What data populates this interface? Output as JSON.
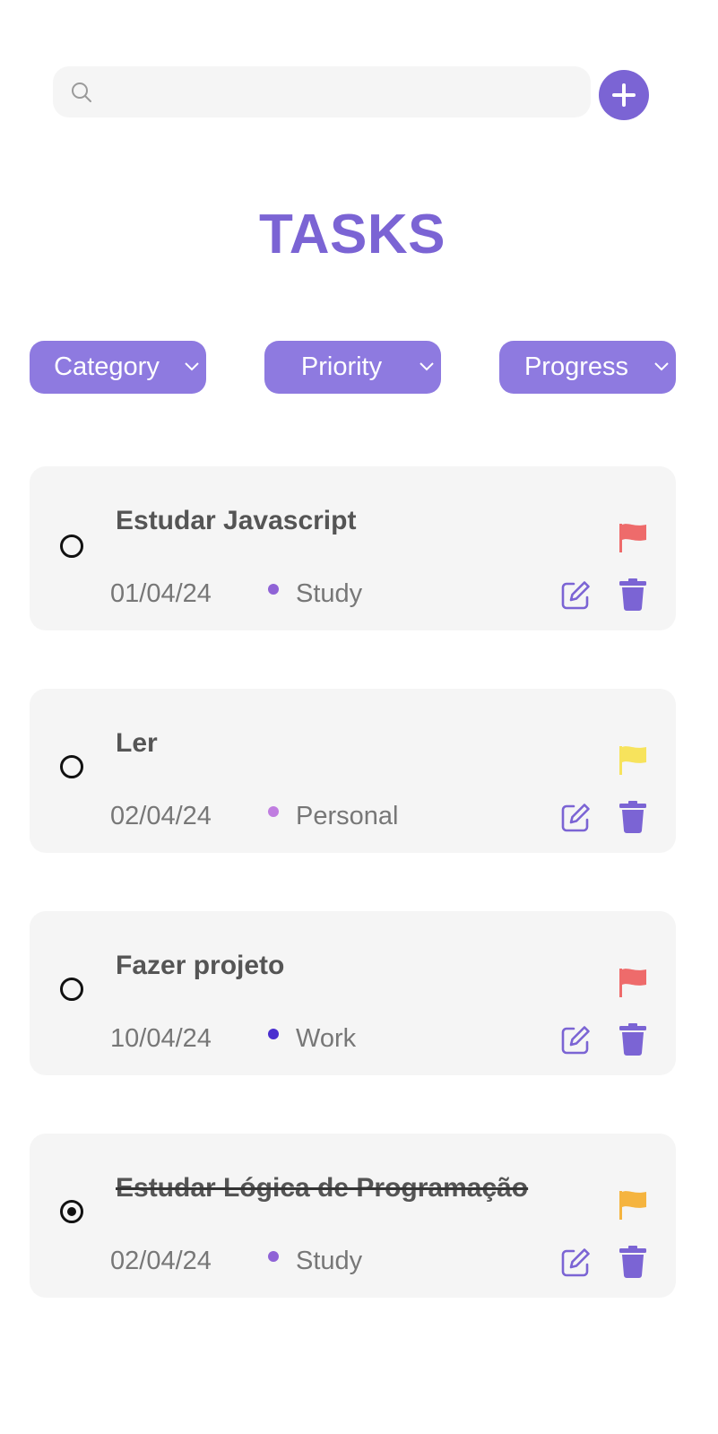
{
  "search": {
    "value": "",
    "placeholder": "",
    "icon": "search-icon"
  },
  "add_button": {
    "icon": "plus-icon",
    "color": "#7b64d4"
  },
  "title": "TASKS",
  "filters": [
    {
      "label": "Category",
      "icon": "chevron-down-icon"
    },
    {
      "label": "Priority",
      "icon": "chevron-down-icon"
    },
    {
      "label": "Progress",
      "icon": "chevron-down-icon"
    }
  ],
  "tasks": [
    {
      "title": "Estudar Javascript",
      "date": "01/04/24",
      "category": "Study",
      "category_color": "#8f63d6",
      "priority_color": "#ee6b6b",
      "done": false
    },
    {
      "title": "Ler",
      "date": "02/04/24",
      "category": "Personal",
      "category_color": "#c07de0",
      "priority_color": "#f7e35c",
      "done": false
    },
    {
      "title": "Fazer projeto",
      "date": "10/04/24",
      "category": "Work",
      "category_color": "#4a2fcf",
      "priority_color": "#ee6b6b",
      "done": false
    },
    {
      "title": "Estudar Lógica de Programação",
      "date": "02/04/24",
      "category": "Study",
      "category_color": "#8f63d6",
      "priority_color": "#f5b43f",
      "done": true
    }
  ],
  "colors": {
    "accent": "#7b64d4",
    "filter_bg": "#8e7ae0",
    "card_bg": "#f5f5f5"
  }
}
